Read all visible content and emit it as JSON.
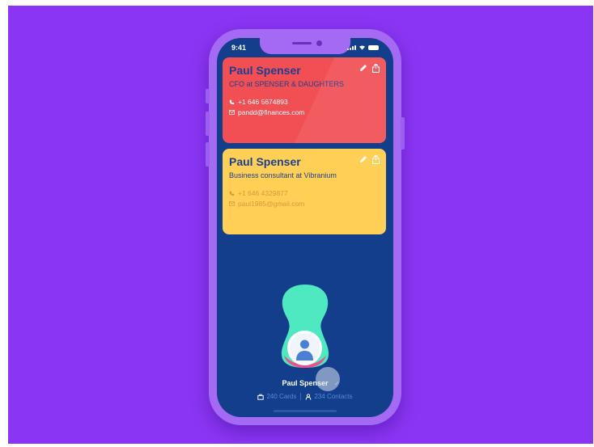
{
  "status_bar": {
    "time": "9:41"
  },
  "cards": [
    {
      "name": "Paul Spenser",
      "title": "CFO at SPENSER & DAUGHTERS",
      "phone": "+1 646 5674893",
      "email": "pandd@finances.com",
      "color": "#f24f54"
    },
    {
      "name": "Paul Spenser",
      "title": "Business consultant at Vibranium",
      "phone": "+1 646 4329877",
      "email": "paul1985@gmail.com",
      "color": "#ffcf56"
    }
  ],
  "profile": {
    "name": "Paul Spenser",
    "cards_count": "240 Cards",
    "contacts_count": "234 Contacts",
    "blob_color": "#4ee8c1",
    "accent_color": "#ee4f8e"
  },
  "icons": {
    "edit": "pencil-icon",
    "share": "share-icon",
    "phone": "phone-icon",
    "email": "mail-icon",
    "cards": "card-stack-icon",
    "contacts": "person-icon"
  },
  "colors": {
    "background": "#8a35f3",
    "phone_frame": "#a56af3",
    "screen": "#123e8c",
    "text_dark": "#1d3f8f"
  }
}
